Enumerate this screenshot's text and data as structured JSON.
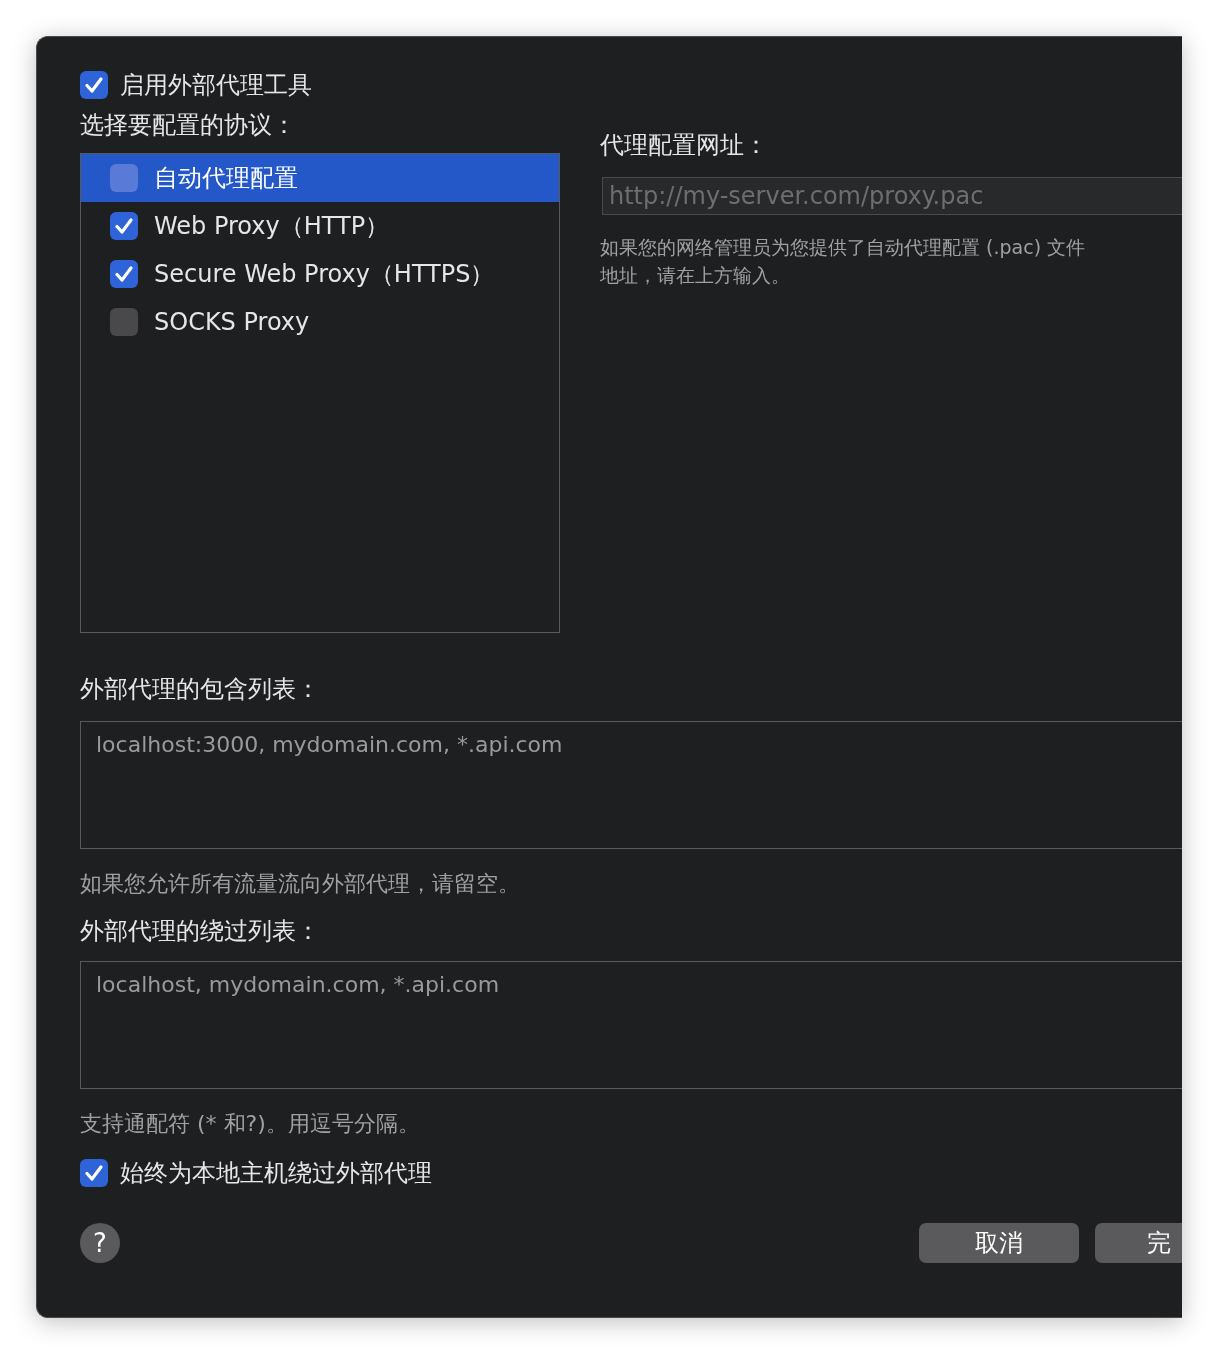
{
  "enable_proxy": {
    "label": "启用外部代理工具",
    "checked": true
  },
  "protocols": {
    "label": "选择要配置的协议：",
    "items": [
      {
        "label": "自动代理配置",
        "checked": false,
        "selected": true
      },
      {
        "label": "Web Proxy（HTTP）",
        "checked": true,
        "selected": false
      },
      {
        "label": "Secure Web Proxy（HTTPS）",
        "checked": true,
        "selected": false
      },
      {
        "label": "SOCKS Proxy",
        "checked": false,
        "selected": false
      }
    ]
  },
  "pac": {
    "label": "代理配置网址：",
    "placeholder": "http://my-server.com/proxy.pac",
    "help_lines": [
      "如果您的网络管理员为您提供了自动代理配置 (.pac) 文件",
      "地址，请在上方输入。"
    ]
  },
  "include_list": {
    "label": "外部代理的包含列表：",
    "placeholder": "localhost:3000, mydomain.com, *.api.com",
    "note": "如果您允许所有流量流向外部代理，请留空。"
  },
  "bypass_list": {
    "label": "外部代理的绕过列表：",
    "placeholder": "localhost, mydomain.com, *.api.com",
    "note": "支持通配符 (* 和?)。用逗号分隔。"
  },
  "bypass_local": {
    "label": "始终为本地主机绕过外部代理",
    "checked": true
  },
  "help_button": "?",
  "buttons": [
    "取消",
    "完"
  ]
}
